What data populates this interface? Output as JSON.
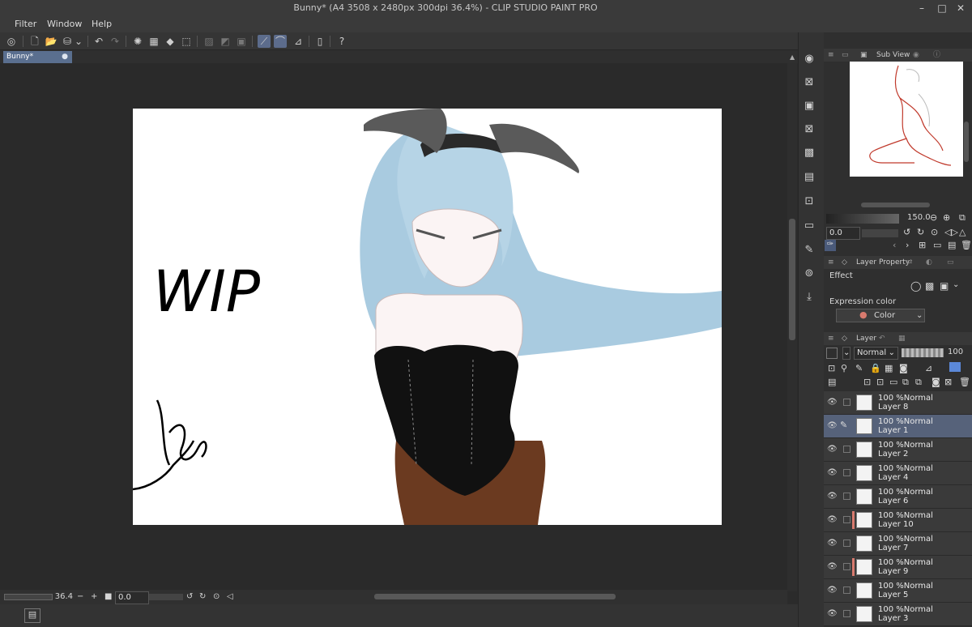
{
  "window": {
    "title": "Bunny* (A4 3508 x 2480px 300dpi 36.4%)  - CLIP STUDIO PAINT PRO"
  },
  "menu": [
    "Filter",
    "Window",
    "Help"
  ],
  "document": {
    "tab_label": "Bunny*",
    "wip_text": "WIP"
  },
  "status": {
    "zoom": "36.4",
    "rotation": "0.0"
  },
  "subview": {
    "tab_label": "Sub View",
    "zoom_value": "150.0",
    "rotation_value": "0.0"
  },
  "layer_property": {
    "tab_label": "Layer Property",
    "effect_label": "Effect",
    "expression_color_label": "Expression color",
    "expression_color_value": "Color"
  },
  "layer_panel": {
    "tab_label": "Layer",
    "blend_mode": "Normal",
    "opacity": "100",
    "layers": [
      {
        "mode": "100 %Normal",
        "name": "Layer 8",
        "selected": false,
        "pen": false,
        "color_bar": false
      },
      {
        "mode": "100 %Normal",
        "name": "Layer 1",
        "selected": true,
        "pen": true,
        "color_bar": false
      },
      {
        "mode": "100 %Normal",
        "name": "Layer 2",
        "selected": false,
        "pen": false,
        "color_bar": false
      },
      {
        "mode": "100 %Normal",
        "name": "Layer 4",
        "selected": false,
        "pen": false,
        "color_bar": false
      },
      {
        "mode": "100 %Normal",
        "name": "Layer 6",
        "selected": false,
        "pen": false,
        "color_bar": false
      },
      {
        "mode": "100 %Normal",
        "name": "Layer 10",
        "selected": false,
        "pen": false,
        "color_bar": true
      },
      {
        "mode": "100 %Normal",
        "name": "Layer 7",
        "selected": false,
        "pen": false,
        "color_bar": false
      },
      {
        "mode": "100 %Normal",
        "name": "Layer 9",
        "selected": false,
        "pen": false,
        "color_bar": true
      },
      {
        "mode": "100 %Normal",
        "name": "Layer 5",
        "selected": false,
        "pen": false,
        "color_bar": false
      },
      {
        "mode": "100 %Normal",
        "name": "Layer 3",
        "selected": false,
        "pen": false,
        "color_bar": false
      }
    ]
  },
  "colors": {
    "accent": "#5a6f8f",
    "selected_layer": "#56627a",
    "hair": "#a9cbe0",
    "bodysuit": "#111111",
    "tights": "#6b3a20",
    "layer_color_bar": "#d87a6e"
  }
}
